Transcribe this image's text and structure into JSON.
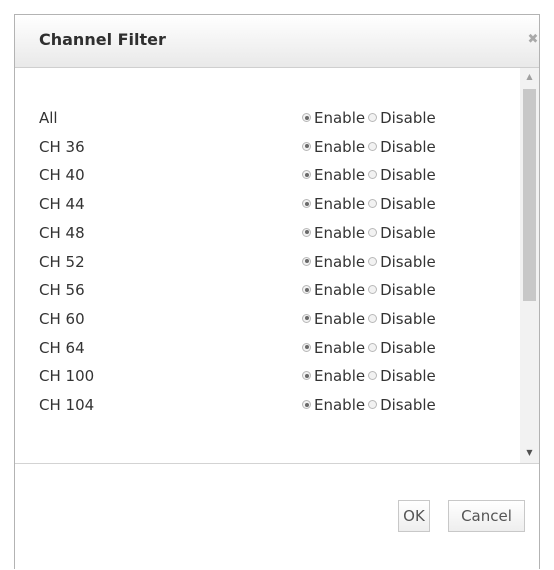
{
  "dialog": {
    "title": "Channel Filter",
    "close_glyph": "✖"
  },
  "options": {
    "enable_label": "Enable",
    "disable_label": "Disable"
  },
  "rows": [
    {
      "label": "All",
      "selected": "Enable"
    },
    {
      "label": "CH 36",
      "selected": "Enable"
    },
    {
      "label": "CH 40",
      "selected": "Enable"
    },
    {
      "label": "CH 44",
      "selected": "Enable"
    },
    {
      "label": "CH 48",
      "selected": "Enable"
    },
    {
      "label": "CH 52",
      "selected": "Enable"
    },
    {
      "label": "CH 56",
      "selected": "Enable"
    },
    {
      "label": "CH 60",
      "selected": "Enable"
    },
    {
      "label": "CH 64",
      "selected": "Enable"
    },
    {
      "label": "CH 100",
      "selected": "Enable"
    },
    {
      "label": "CH 104",
      "selected": "Enable"
    }
  ],
  "scrollbar": {
    "up_glyph": "▲",
    "down_glyph": "▼"
  },
  "footer": {
    "ok_label": "OK",
    "cancel_label": "Cancel"
  }
}
